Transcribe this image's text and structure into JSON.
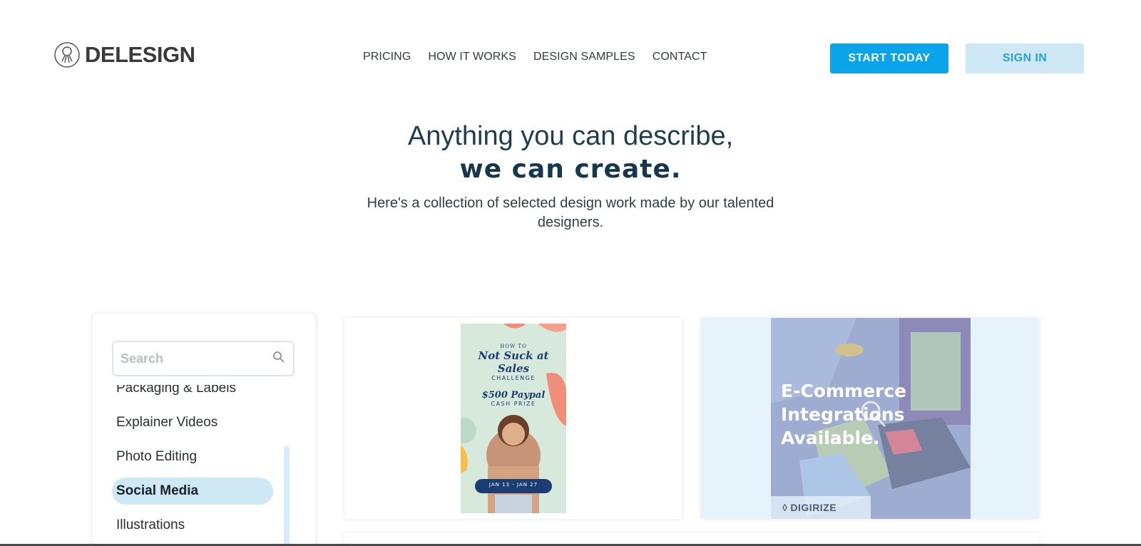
{
  "brand": {
    "name": "DELESIGN"
  },
  "nav": {
    "items": [
      "PRICING",
      "HOW IT WORKS",
      "DESIGN SAMPLES",
      "CONTACT"
    ]
  },
  "cta": {
    "start_label": "START TODAY",
    "signin_label": "SIGN IN"
  },
  "hero": {
    "line1": "Anything you can describe,",
    "line2": "we can create.",
    "subtitle": "Here's a collection of selected design work made by our talented designers."
  },
  "sidebar": {
    "search_placeholder": "Search",
    "categories": [
      {
        "label": "Packaging & Labels",
        "active": false
      },
      {
        "label": "Explainer Videos",
        "active": false
      },
      {
        "label": "Photo Editing",
        "active": false
      },
      {
        "label": "Social Media",
        "active": true
      },
      {
        "label": "Illustrations",
        "active": false
      }
    ]
  },
  "gallery": {
    "poster": {
      "line1": "HOW TO",
      "line2": "Not Suck at Sales",
      "line3": "CHALLENGE",
      "line4": "$500 Paypal",
      "line5": "CASH PRIZE",
      "line6": "JAN 13 - JAN 27"
    },
    "ecommerce": {
      "text_lines": [
        "E-Commerce",
        "Integrations",
        "Available."
      ],
      "brand": "DIGIRIZE"
    }
  },
  "colors": {
    "accent": "#0aa4ea",
    "accent_light": "#cfe8f6",
    "heading": "#1f3d4f"
  }
}
